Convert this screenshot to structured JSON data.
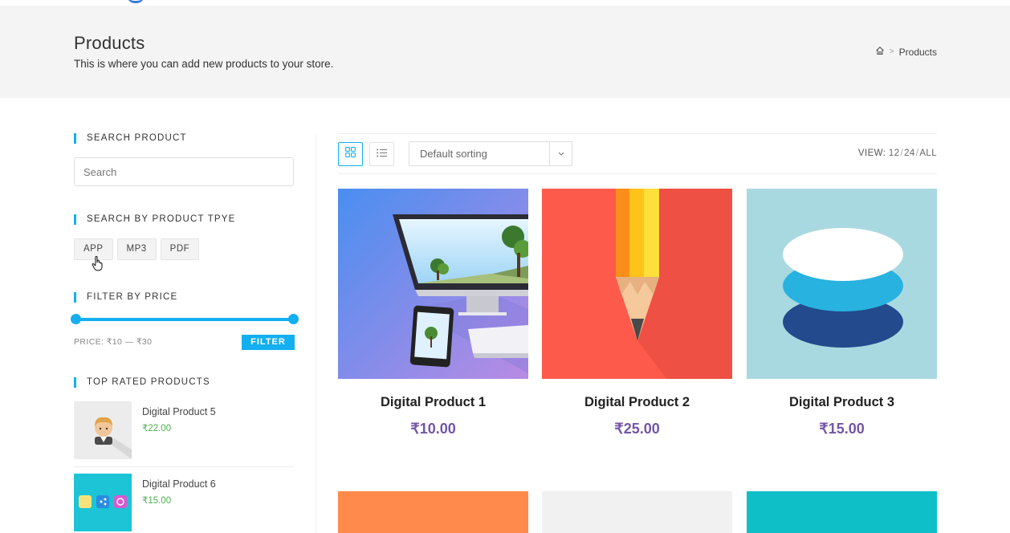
{
  "header": {
    "title": "Products",
    "subtitle": "This is where you can add new products to your store.",
    "breadcrumb_current": "Products"
  },
  "sidebar": {
    "search_title": "SEARCH PRODUCT",
    "search_placeholder": "Search",
    "type_title": "SEARCH BY PRODUCT TPYE",
    "types": [
      "APP",
      "MP3",
      "PDF"
    ],
    "price_title": "FILTER BY PRICE",
    "price_label": "PRICE: ₹10 — ₹30",
    "filter_button": "FILTER",
    "top_title": "TOP RATED PRODUCTS",
    "top_products": [
      {
        "name": "Digital Product 5",
        "price": "₹22.00"
      },
      {
        "name": "Digital Product 6",
        "price": "₹15.00"
      }
    ]
  },
  "toolbar": {
    "sort_label": "Default sorting",
    "view_label": "VIEW:",
    "view_options": [
      "12",
      "24",
      "ALL"
    ]
  },
  "products": [
    {
      "title": "Digital Product 1",
      "price": "₹10.00"
    },
    {
      "title": "Digital Product 2",
      "price": "₹25.00"
    },
    {
      "title": "Digital Product 3",
      "price": "₹15.00"
    }
  ],
  "colors": {
    "accent": "#13aff0",
    "price": "#7356a6",
    "green": "#4caf50"
  },
  "icons": [
    "home-icon",
    "grid-view-icon",
    "list-view-icon",
    "chevron-down-icon",
    "hand-cursor-icon"
  ]
}
